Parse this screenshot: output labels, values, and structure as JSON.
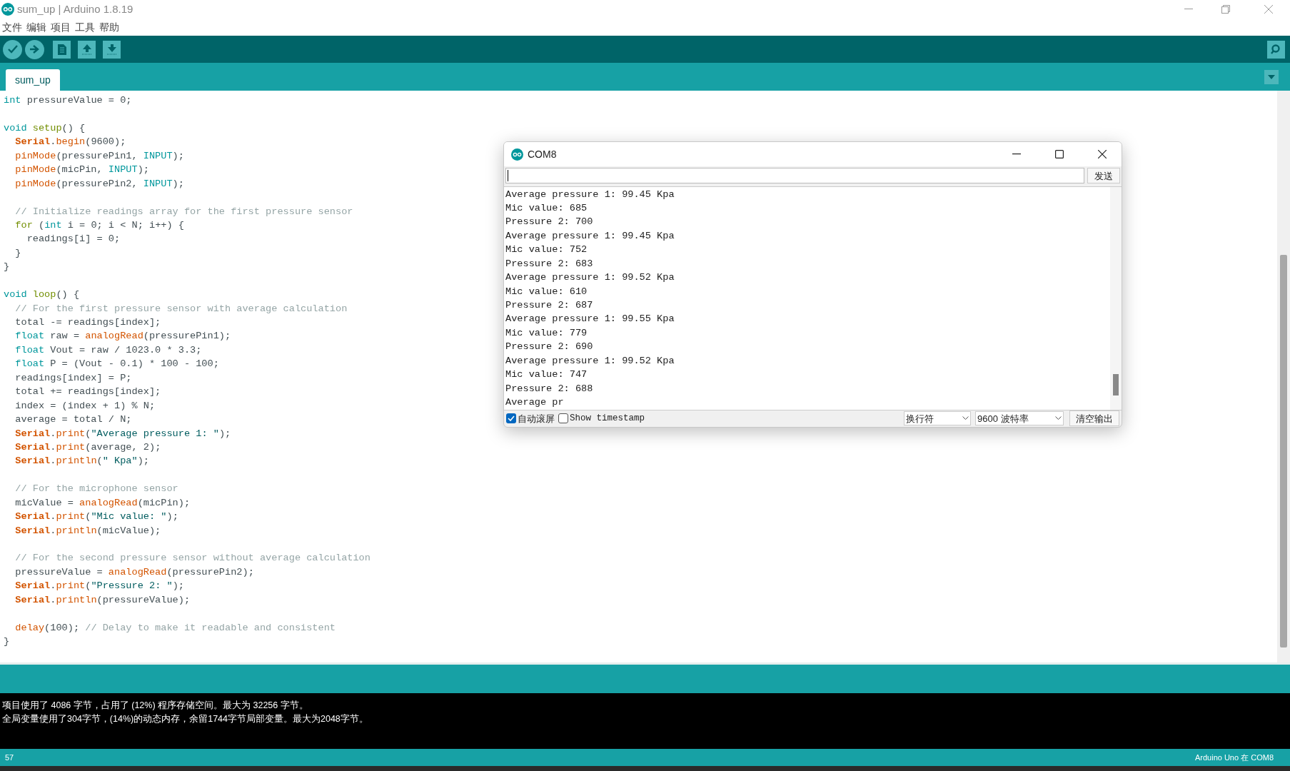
{
  "window": {
    "title": "sum_up | Arduino 1.8.19"
  },
  "menu": [
    "文件",
    "编辑",
    "项目",
    "工具",
    "帮助"
  ],
  "tabs": [
    {
      "label": "sum_up",
      "selected": true
    }
  ],
  "editor": {
    "blocks": [
      {
        "lines": [
          {
            "segments": [
              {
                "kind": "type",
                "text": "int"
              },
              {
                "kind": "plain",
                "text": " pressureValue = 0;"
              }
            ]
          }
        ]
      },
      {
        "lines": [
          {
            "segments": [
              {
                "kind": "type",
                "text": "void "
              },
              {
                "kind": "struct",
                "text": "setup"
              },
              {
                "kind": "plain",
                "text": "() {"
              }
            ]
          },
          {
            "segments": [
              {
                "kind": "serial",
                "text": "  Serial"
              },
              {
                "kind": "plain",
                "text": "."
              },
              {
                "kind": "func",
                "text": "begin"
              },
              {
                "kind": "plain",
                "text": "(9600);"
              }
            ]
          },
          {
            "segments": [
              {
                "kind": "func",
                "text": "  pinMode"
              },
              {
                "kind": "plain",
                "text": "(pressurePin1, "
              },
              {
                "kind": "const",
                "text": "INPUT"
              },
              {
                "kind": "plain",
                "text": ");"
              }
            ]
          },
          {
            "segments": [
              {
                "kind": "func",
                "text": "  pinMode"
              },
              {
                "kind": "plain",
                "text": "(micPin, "
              },
              {
                "kind": "const",
                "text": "INPUT"
              },
              {
                "kind": "plain",
                "text": ");"
              }
            ]
          },
          {
            "segments": [
              {
                "kind": "func",
                "text": "  pinMode"
              },
              {
                "kind": "plain",
                "text": "(pressurePin2, "
              },
              {
                "kind": "const",
                "text": "INPUT"
              },
              {
                "kind": "plain",
                "text": ");"
              }
            ]
          }
        ]
      },
      {
        "lines": [
          {
            "segments": [
              {
                "kind": "comment",
                "text": "  // Initialize readings array for the first pressure sensor"
              }
            ]
          },
          {
            "segments": [
              {
                "kind": "struct",
                "text": "  for"
              },
              {
                "kind": "plain",
                "text": " ("
              },
              {
                "kind": "type",
                "text": "int"
              },
              {
                "kind": "plain",
                "text": " i = 0; i < N; i++) {"
              }
            ]
          },
          {
            "segments": [
              {
                "kind": "plain",
                "text": "    readings[i] = 0;"
              }
            ]
          },
          {
            "segments": [
              {
                "kind": "plain",
                "text": "  }"
              }
            ]
          },
          {
            "segments": [
              {
                "kind": "plain",
                "text": "}"
              }
            ]
          }
        ]
      },
      {
        "lines": [
          {
            "segments": [
              {
                "kind": "type",
                "text": "void "
              },
              {
                "kind": "struct",
                "text": "loop"
              },
              {
                "kind": "plain",
                "text": "() {"
              }
            ]
          },
          {
            "segments": [
              {
                "kind": "comment",
                "text": "  // For the first pressure sensor with average calculation"
              }
            ]
          },
          {
            "segments": [
              {
                "kind": "plain",
                "text": "  total -= readings[index];"
              }
            ]
          },
          {
            "segments": [
              {
                "kind": "type",
                "text": "  float"
              },
              {
                "kind": "plain",
                "text": " raw = "
              },
              {
                "kind": "func",
                "text": "analogRead"
              },
              {
                "kind": "plain",
                "text": "(pressurePin1);"
              }
            ]
          },
          {
            "segments": [
              {
                "kind": "type",
                "text": "  float"
              },
              {
                "kind": "plain",
                "text": " Vout = raw / 1023.0 * 3.3;"
              }
            ]
          },
          {
            "segments": [
              {
                "kind": "type",
                "text": "  float"
              },
              {
                "kind": "plain",
                "text": " P = (Vout - 0.1) * 100 - 100;"
              }
            ]
          },
          {
            "segments": [
              {
                "kind": "plain",
                "text": "  readings[index] = P;"
              }
            ]
          },
          {
            "segments": [
              {
                "kind": "plain",
                "text": "  total += readings[index];"
              }
            ]
          },
          {
            "segments": [
              {
                "kind": "plain",
                "text": "  index = (index + 1) % N;"
              }
            ]
          },
          {
            "segments": [
              {
                "kind": "plain",
                "text": "  average = total / N;"
              }
            ]
          },
          {
            "segments": [
              {
                "kind": "serial",
                "text": "  Serial"
              },
              {
                "kind": "plain",
                "text": "."
              },
              {
                "kind": "func",
                "text": "print"
              },
              {
                "kind": "plain",
                "text": "("
              },
              {
                "kind": "str",
                "text": "\"Average pressure 1: \""
              },
              {
                "kind": "plain",
                "text": ");"
              }
            ]
          },
          {
            "segments": [
              {
                "kind": "serial",
                "text": "  Serial"
              },
              {
                "kind": "plain",
                "text": "."
              },
              {
                "kind": "func",
                "text": "print"
              },
              {
                "kind": "plain",
                "text": "(average, 2);"
              }
            ]
          },
          {
            "segments": [
              {
                "kind": "serial",
                "text": "  Serial"
              },
              {
                "kind": "plain",
                "text": "."
              },
              {
                "kind": "func",
                "text": "println"
              },
              {
                "kind": "plain",
                "text": "("
              },
              {
                "kind": "str",
                "text": "\" Kpa\""
              },
              {
                "kind": "plain",
                "text": ");"
              }
            ]
          }
        ]
      },
      {
        "lines": [
          {
            "segments": [
              {
                "kind": "comment",
                "text": "  // For the microphone sensor"
              }
            ]
          },
          {
            "segments": [
              {
                "kind": "plain",
                "text": "  micValue = "
              },
              {
                "kind": "func",
                "text": "analogRead"
              },
              {
                "kind": "plain",
                "text": "(micPin);"
              }
            ]
          },
          {
            "segments": [
              {
                "kind": "serial",
                "text": "  Serial"
              },
              {
                "kind": "plain",
                "text": "."
              },
              {
                "kind": "func",
                "text": "print"
              },
              {
                "kind": "plain",
                "text": "("
              },
              {
                "kind": "str",
                "text": "\"Mic value: \""
              },
              {
                "kind": "plain",
                "text": ");"
              }
            ]
          },
          {
            "segments": [
              {
                "kind": "serial",
                "text": "  Serial"
              },
              {
                "kind": "plain",
                "text": "."
              },
              {
                "kind": "func",
                "text": "println"
              },
              {
                "kind": "plain",
                "text": "(micValue);"
              }
            ]
          }
        ]
      },
      {
        "lines": [
          {
            "segments": [
              {
                "kind": "comment",
                "text": "  // For the second pressure sensor without average calculation"
              }
            ]
          },
          {
            "segments": [
              {
                "kind": "plain",
                "text": "  pressureValue = "
              },
              {
                "kind": "func",
                "text": "analogRead"
              },
              {
                "kind": "plain",
                "text": "(pressurePin2);"
              }
            ]
          },
          {
            "segments": [
              {
                "kind": "serial",
                "text": "  Serial"
              },
              {
                "kind": "plain",
                "text": "."
              },
              {
                "kind": "func",
                "text": "print"
              },
              {
                "kind": "plain",
                "text": "("
              },
              {
                "kind": "str",
                "text": "\"Pressure 2: \""
              },
              {
                "kind": "plain",
                "text": ");"
              }
            ]
          },
          {
            "segments": [
              {
                "kind": "serial",
                "text": "  Serial"
              },
              {
                "kind": "plain",
                "text": "."
              },
              {
                "kind": "func",
                "text": "println"
              },
              {
                "kind": "plain",
                "text": "(pressureValue);"
              }
            ]
          }
        ]
      },
      {
        "lines": [
          {
            "segments": [
              {
                "kind": "func",
                "text": "  delay"
              },
              {
                "kind": "plain",
                "text": "(100); "
              },
              {
                "kind": "comment",
                "text": "// Delay to make it readable and consistent"
              }
            ]
          },
          {
            "segments": [
              {
                "kind": "plain",
                "text": "}"
              }
            ]
          }
        ]
      }
    ]
  },
  "console": {
    "lines": [
      "项目使用了 4086 字节，占用了 (12%) 程序存储空间。最大为 32256 字节。",
      "全局变量使用了304字节，(14%)的动态内存，余留1744字节局部变量。最大为2048字节。"
    ]
  },
  "status_bar": {
    "line": "57",
    "board": "Arduino Uno 在 COM8"
  },
  "serial_monitor": {
    "title": "COM8",
    "send_button": "发送",
    "output": [
      "Average pressure 1: 99.45 Kpa",
      "Mic value: 685",
      "Pressure 2: 700",
      "Average pressure 1: 99.45 Kpa",
      "Mic value: 752",
      "Pressure 2: 683",
      "Average pressure 1: 99.52 Kpa",
      "Mic value: 610",
      "Pressure 2: 687",
      "Average pressure 1: 99.55 Kpa",
      "Mic value: 779",
      "Pressure 2: 690",
      "Average pressure 1: 99.52 Kpa",
      "Mic value: 747",
      "Pressure 2: 688",
      "Average pr"
    ],
    "autoscroll": {
      "label": "自动滚屏",
      "checked": true
    },
    "timestamp": {
      "label": "Show timestamp",
      "checked": false
    },
    "line_ending": "换行符",
    "baud_rate": "9600 波特率",
    "clear_button": "清空输出"
  }
}
